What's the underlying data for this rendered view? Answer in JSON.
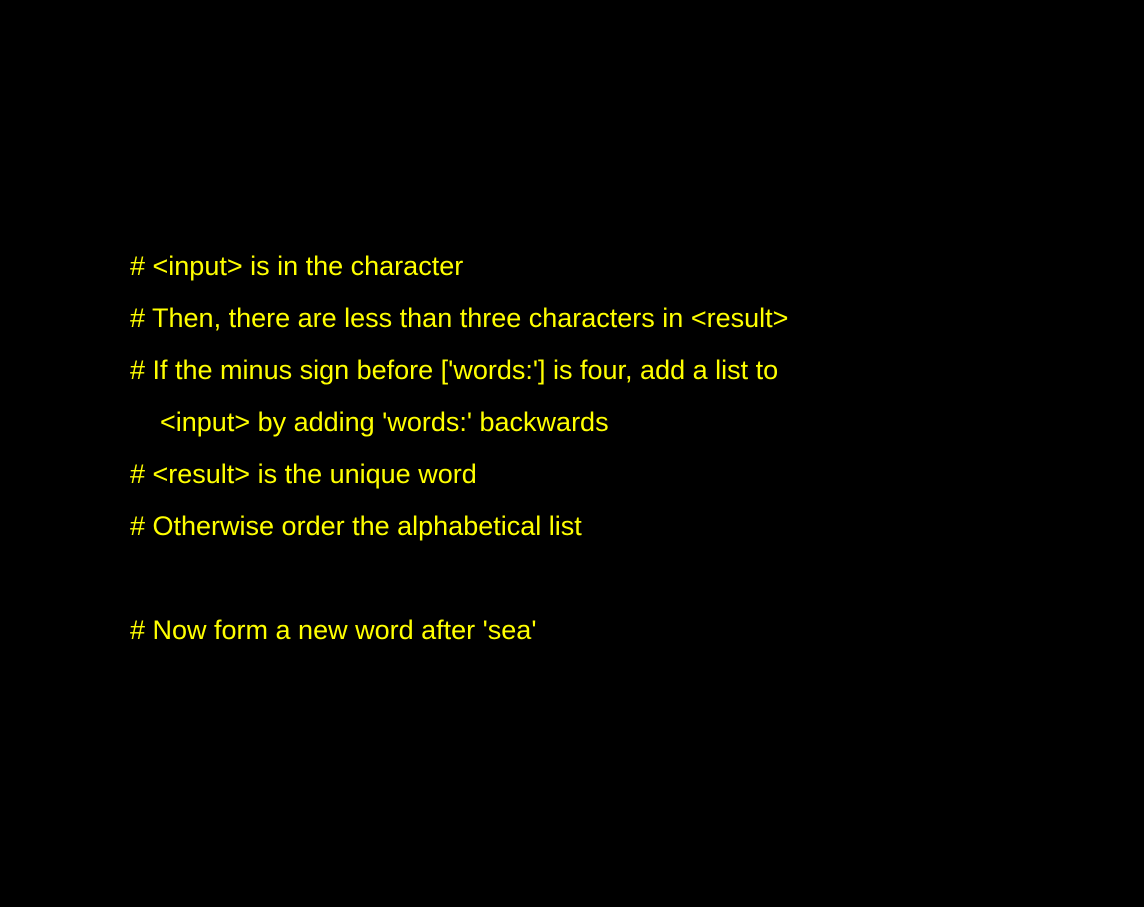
{
  "colors": {
    "background": "#000000",
    "text": "#ffff00"
  },
  "lines": [
    {
      "text": "# <input> is in the character",
      "indent": false
    },
    {
      "text": "# Then, there are less than three characters in <result>",
      "indent": false
    },
    {
      "text": "# If the minus sign before ['words:'] is four, add a list to",
      "indent": false
    },
    {
      "text": "<input> by adding 'words:' backwards",
      "indent": true
    },
    {
      "text": "# <result> is the unique word",
      "indent": false
    },
    {
      "text": "# Otherwise order the alphabetical list",
      "indent": false
    },
    {
      "text": "",
      "indent": false
    },
    {
      "text": "# Now form a new word after 'sea'",
      "indent": false
    }
  ]
}
